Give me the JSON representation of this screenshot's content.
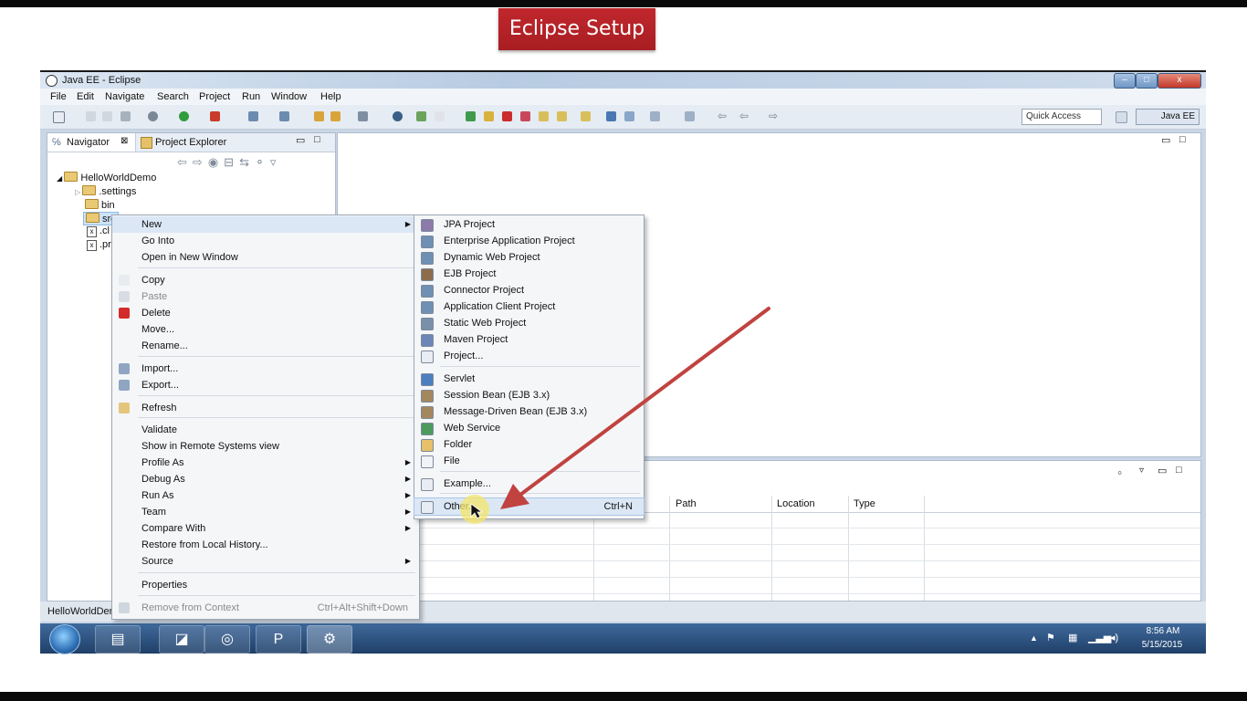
{
  "banner": {
    "title": "Eclipse Setup"
  },
  "window": {
    "title": "Java EE - Eclipse",
    "minimize": "–",
    "maximize": "□",
    "close": "x"
  },
  "menubar": [
    "File",
    "Edit",
    "Navigate",
    "Search",
    "Project",
    "Run",
    "Window",
    "Help"
  ],
  "toolbar": {
    "quick_access": "Quick Access",
    "perspective": "Java EE"
  },
  "navigator": {
    "tab_navigator": "Navigator",
    "tab_close": "⊠",
    "tab_project_explorer": "Project Explorer",
    "tree": {
      "project": "HelloWorldDemo",
      "settings": ".settings",
      "bin": "bin",
      "src": "src",
      "file1": ".cl",
      "file2": ".pr"
    }
  },
  "context_menu": {
    "items": [
      {
        "label": "New",
        "submenu": true
      },
      {
        "label": "Go Into"
      },
      {
        "label": "Open in New Window"
      },
      {
        "label": "Copy"
      },
      {
        "label": "Paste",
        "disabled": true
      },
      {
        "label": "Delete"
      },
      {
        "label": "Move..."
      },
      {
        "label": "Rename..."
      },
      {
        "label": "Import..."
      },
      {
        "label": "Export..."
      },
      {
        "label": "Refresh"
      },
      {
        "label": "Validate"
      },
      {
        "label": "Show in Remote Systems view"
      },
      {
        "label": "Profile As",
        "submenu": true
      },
      {
        "label": "Debug As",
        "submenu": true
      },
      {
        "label": "Run As",
        "submenu": true
      },
      {
        "label": "Team",
        "submenu": true
      },
      {
        "label": "Compare With",
        "submenu": true
      },
      {
        "label": "Restore from Local History..."
      },
      {
        "label": "Source",
        "submenu": true
      },
      {
        "label": "Properties"
      },
      {
        "label": "Remove from Context",
        "shortcut": "Ctrl+Alt+Shift+Down",
        "disabled": true
      }
    ]
  },
  "new_submenu": {
    "items": [
      {
        "label": "JPA Project"
      },
      {
        "label": "Enterprise Application Project"
      },
      {
        "label": "Dynamic Web Project"
      },
      {
        "label": "EJB Project"
      },
      {
        "label": "Connector Project"
      },
      {
        "label": "Application Client Project"
      },
      {
        "label": "Static Web Project"
      },
      {
        "label": "Maven Project"
      },
      {
        "label": "Project..."
      },
      {
        "label": "Servlet"
      },
      {
        "label": "Session Bean (EJB 3.x)"
      },
      {
        "label": "Message-Driven Bean (EJB 3.x)"
      },
      {
        "label": "Web Service"
      },
      {
        "label": "Folder"
      },
      {
        "label": "File"
      },
      {
        "label": "Example..."
      },
      {
        "label": "Other...",
        "shortcut": "Ctrl+N"
      }
    ]
  },
  "bottom_panel": {
    "columns": [
      "Path",
      "Location",
      "Type"
    ]
  },
  "status_bar": {
    "selection": "HelloWorldDer"
  },
  "taskbar": {
    "time": "8:56 AM",
    "date": "5/15/2015"
  },
  "colors": {
    "banner": "#b4232a",
    "arrow": "#c0433f",
    "highlight": "#f4e66a"
  }
}
